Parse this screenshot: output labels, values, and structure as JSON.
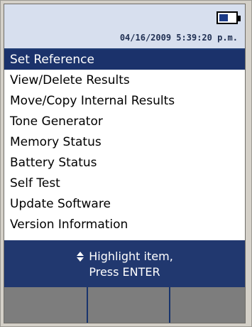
{
  "status": {
    "datetime": "04/16/2009 5:39:20 p.m.",
    "battery_icon": "battery-icon"
  },
  "menu": {
    "items": [
      {
        "label": "Set Reference",
        "selected": true
      },
      {
        "label": "View/Delete Results"
      },
      {
        "label": "Move/Copy Internal Results"
      },
      {
        "label": "Tone Generator"
      },
      {
        "label": "Memory Status"
      },
      {
        "label": "Battery Status"
      },
      {
        "label": "Self Test"
      },
      {
        "label": "Update Software"
      },
      {
        "label": "Version Information"
      }
    ]
  },
  "help": {
    "line1": "Highlight item,",
    "line2": "Press ENTER",
    "icon": "up-down-arrows-icon"
  },
  "softkeys": [
    "",
    "",
    ""
  ],
  "colors": {
    "accent": "#1b326b",
    "status_bg": "#d7dfee",
    "softkey_bg": "#7d7d7d"
  }
}
